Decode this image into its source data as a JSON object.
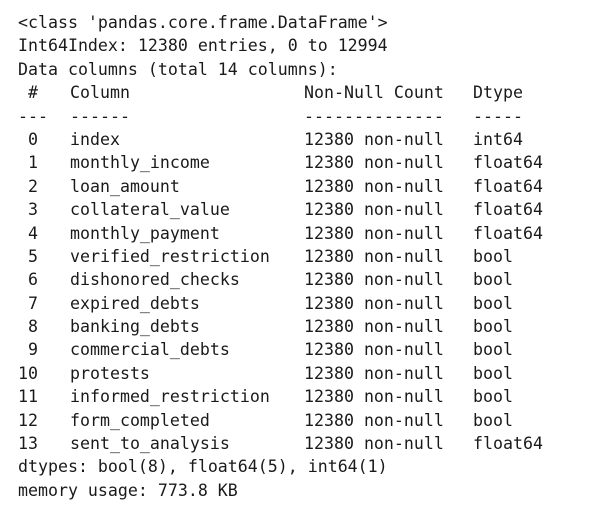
{
  "header": {
    "class_line": "<class 'pandas.core.frame.DataFrame'>",
    "index_line": "Int64Index: 12380 entries, 0 to 12994",
    "columns_line": "Data columns (total 14 columns):"
  },
  "table": {
    "headers": {
      "num": "#",
      "column": "Column",
      "non_null": "Non-Null Count",
      "dtype": "Dtype"
    },
    "separators": {
      "num": "---",
      "column": "------",
      "non_null": "--------------",
      "dtype": "-----"
    },
    "rows": [
      {
        "num": "0",
        "column": "index",
        "non_null": "12380 non-null",
        "dtype": "int64"
      },
      {
        "num": "1",
        "column": "monthly_income",
        "non_null": "12380 non-null",
        "dtype": "float64"
      },
      {
        "num": "2",
        "column": "loan_amount",
        "non_null": "12380 non-null",
        "dtype": "float64"
      },
      {
        "num": "3",
        "column": "collateral_value",
        "non_null": "12380 non-null",
        "dtype": "float64"
      },
      {
        "num": "4",
        "column": "monthly_payment",
        "non_null": "12380 non-null",
        "dtype": "float64"
      },
      {
        "num": "5",
        "column": "verified_restriction",
        "non_null": "12380 non-null",
        "dtype": "bool"
      },
      {
        "num": "6",
        "column": "dishonored_checks",
        "non_null": "12380 non-null",
        "dtype": "bool"
      },
      {
        "num": "7",
        "column": "expired_debts",
        "non_null": "12380 non-null",
        "dtype": "bool"
      },
      {
        "num": "8",
        "column": "banking_debts",
        "non_null": "12380 non-null",
        "dtype": "bool"
      },
      {
        "num": "9",
        "column": "commercial_debts",
        "non_null": "12380 non-null",
        "dtype": "bool"
      },
      {
        "num": "10",
        "column": "protests",
        "non_null": "12380 non-null",
        "dtype": "bool"
      },
      {
        "num": "11",
        "column": "informed_restriction",
        "non_null": "12380 non-null",
        "dtype": "bool"
      },
      {
        "num": "12",
        "column": "form_completed",
        "non_null": "12380 non-null",
        "dtype": "bool"
      },
      {
        "num": "13",
        "column": "sent_to_analysis",
        "non_null": "12380 non-null",
        "dtype": "float64"
      }
    ]
  },
  "footer": {
    "dtypes_line": "dtypes: bool(8), float64(5), int64(1)",
    "memory_line": "memory usage: 773.8 KB"
  }
}
